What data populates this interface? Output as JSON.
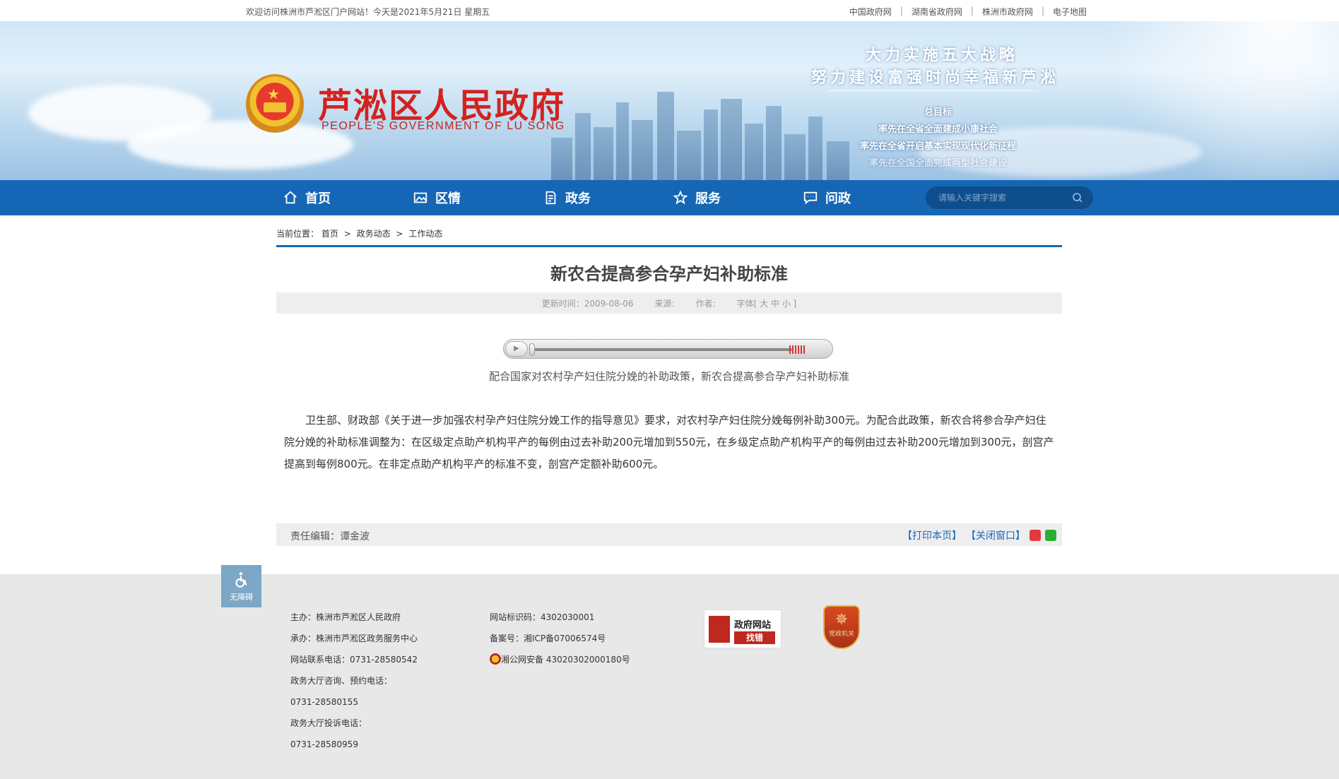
{
  "topbar": {
    "welcome": "欢迎访问株洲市芦淞区门户网站！今天是2021年5月21日 星期五",
    "links": [
      "中国政府网",
      "湖南省政府网",
      "株洲市政府网",
      "电子地图"
    ],
    "separator": "|"
  },
  "banner": {
    "title": "芦淞区人民政府",
    "subtitle": "PEOPLE'S GOVERNMENT OF  LU SONG",
    "slogan1": "大力实施五大战略",
    "slogan2": "努力建设富强时尚幸福新芦淞",
    "goals_heading": "总目标",
    "goals": [
      "率先在全省全面建成小康社会",
      "率先在全省开启基本实现现代化新征程",
      "率先在全国全面完成两型社会建设"
    ]
  },
  "nav": {
    "items": [
      {
        "label": "首页",
        "icon": "home-icon"
      },
      {
        "label": "区情",
        "icon": "picture-icon"
      },
      {
        "label": "政务",
        "icon": "document-icon"
      },
      {
        "label": "服务",
        "icon": "star-icon"
      },
      {
        "label": "问政",
        "icon": "chat-icon"
      }
    ],
    "search_placeholder": "请输入关键字搜索"
  },
  "breadcrumb": {
    "label": "当前位置：",
    "items": [
      "首页",
      "政务动态",
      "工作动态"
    ],
    "arrow": ">"
  },
  "article": {
    "title": "新农合提高参合孕产妇补助标准",
    "updated": "更新时间：2009-08-06",
    "source": "来源:",
    "author": "作者:",
    "fontsize": "字体[ 大 中 小 ]",
    "caption": "配合国家对农村孕产妇住院分娩的补助政策，新农合提高参合孕产妇补助标准",
    "body": "卫生部、财政部《关于进一步加强农村孕产妇住院分娩工作的指导意见》要求，对农村孕产妇住院分娩每例补助300元。为配合此政策，新农合将参合孕产妇住院分娩的补助标准调整为：在区级定点助产机构平产的每例由过去补助200元增加到550元，在乡级定点助产机构平产的每例由过去补助200元增加到300元，剖宫产提高到每例800元。在非定点助产机构平产的标准不变，剖宫产定额补助600元。",
    "editor": "责任编辑：谭金波",
    "print": "【打印本页】",
    "close": "【关闭窗口】"
  },
  "accessibility": {
    "label": "无障碍"
  },
  "footer": {
    "col1": [
      "主办：株洲市芦淞区人民政府",
      "承办：株洲市芦淞区政务服务中心",
      "网站联系电话：0731-28580542",
      "政务大厅咨询、预约电话：",
      "0731-28580155",
      "政务大厅投诉电话：",
      "0731-28580959"
    ],
    "site_id": "网站标识码：4302030001",
    "icp": "备案号：湘ICP备07006574号",
    "police": "湘公网安备 43020302000180号",
    "find_error_line1": "政府网站",
    "find_error_line2": "找错",
    "party_label": "党政机关"
  },
  "colors": {
    "nav_blue": "#1567b5",
    "title_red": "#d3221f",
    "footer_gray": "#e8e8e8"
  }
}
